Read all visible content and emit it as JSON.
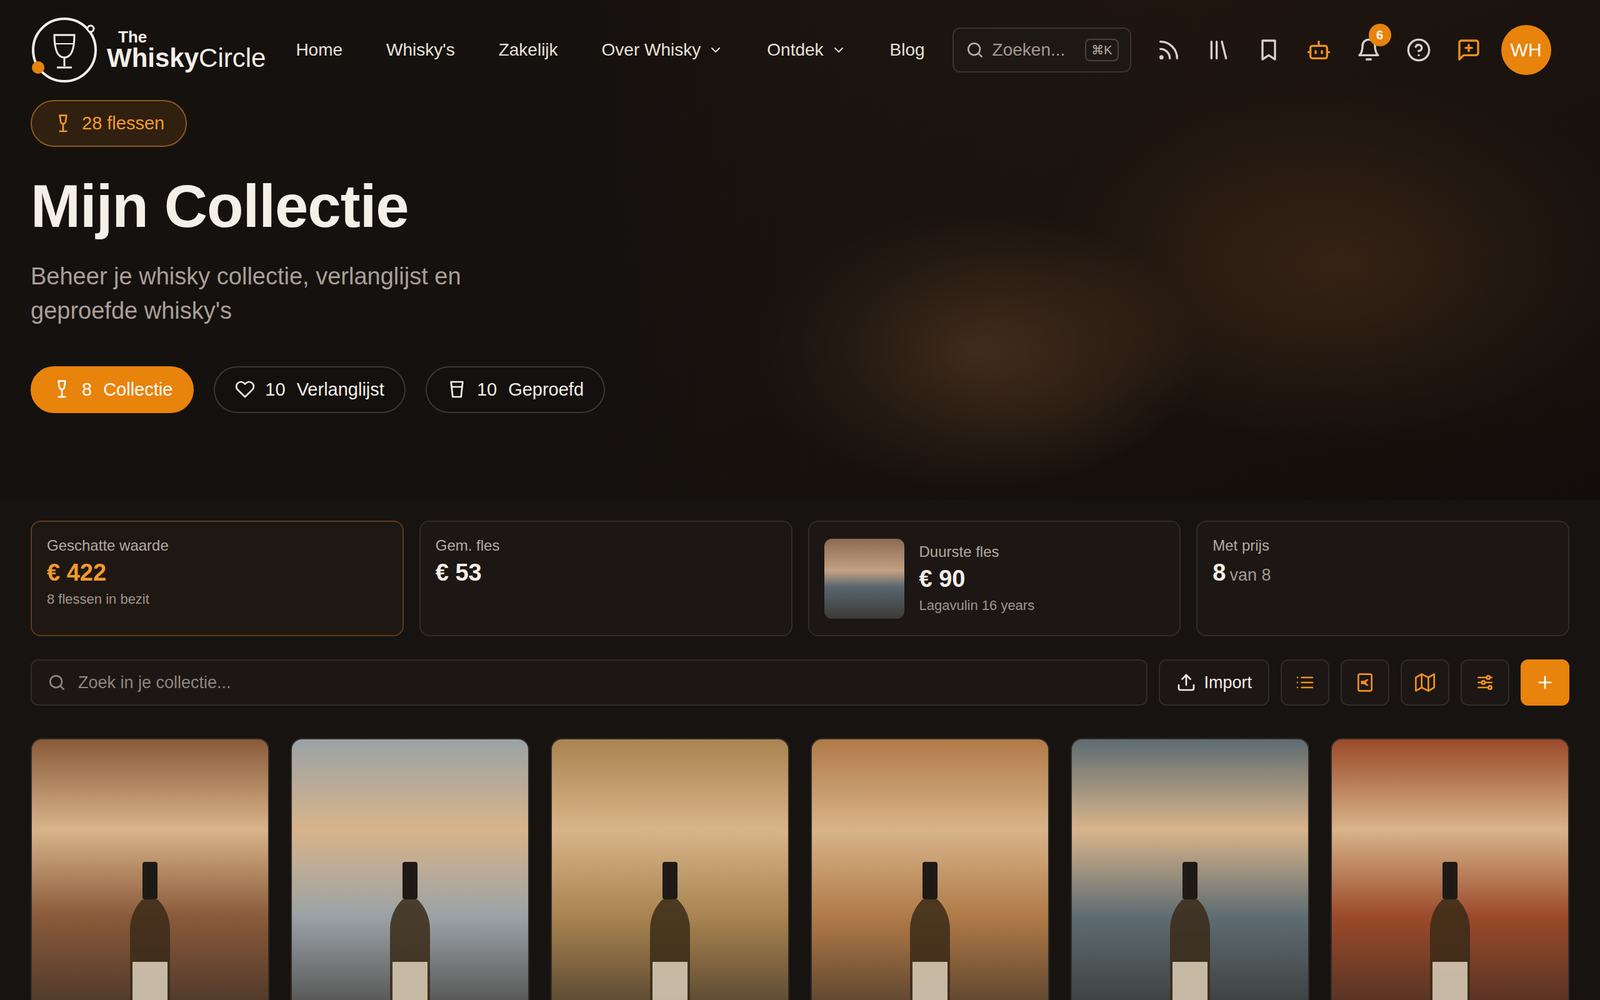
{
  "logo": {
    "the": "The",
    "brand_bold": "Whisky",
    "brand_light": "Circle"
  },
  "nav": {
    "items": [
      {
        "label": "Home",
        "kind": "link"
      },
      {
        "label": "Whisky's",
        "kind": "link"
      },
      {
        "label": "Zakelijk",
        "kind": "link"
      },
      {
        "label": "Over Whisky",
        "kind": "dropdown"
      },
      {
        "label": "Ontdek",
        "kind": "dropdown"
      },
      {
        "label": "Blog",
        "kind": "link"
      }
    ]
  },
  "search": {
    "placeholder": "Zoeken...",
    "shortcut": "⌘K"
  },
  "header": {
    "notifications_badge": "6",
    "avatar": "WH"
  },
  "hero": {
    "badge": "28 flessen",
    "title": "Mijn Collectie",
    "subtitle": "Beheer je whisky collectie, verlanglijst en geproefde whisky's",
    "tabs": [
      {
        "count": "8",
        "label": "Collectie",
        "selected": true,
        "kind": "glass"
      },
      {
        "count": "10",
        "label": "Verlanglijst",
        "selected": false,
        "kind": "heart"
      },
      {
        "count": "10",
        "label": "Geproefd",
        "selected": false,
        "kind": "tumbler"
      }
    ]
  },
  "stats": [
    {
      "label": "Geschatte waarde",
      "value": "€ 422",
      "sub": "8 flessen in bezit",
      "kind": "highlight"
    },
    {
      "label": "Gem. fles",
      "value": "€ 53",
      "kind": "plain"
    },
    {
      "label": "Duurste fles",
      "value": "€ 90",
      "sub": "Lagavulin 16 years",
      "kind": "image"
    },
    {
      "label": "Met prijs",
      "value": "8",
      "suffix": "van 8",
      "kind": "ratio"
    }
  ],
  "collection": {
    "search_placeholder": "Zoek in je collectie...",
    "import_label": "Import",
    "bottles": [
      {
        "color": "#8a5a3a"
      },
      {
        "color": "#9aa2a6"
      },
      {
        "color": "#a88450"
      },
      {
        "color": "#b07a48"
      },
      {
        "color": "#5e6c72"
      },
      {
        "color": "#9a4a2a"
      }
    ]
  }
}
